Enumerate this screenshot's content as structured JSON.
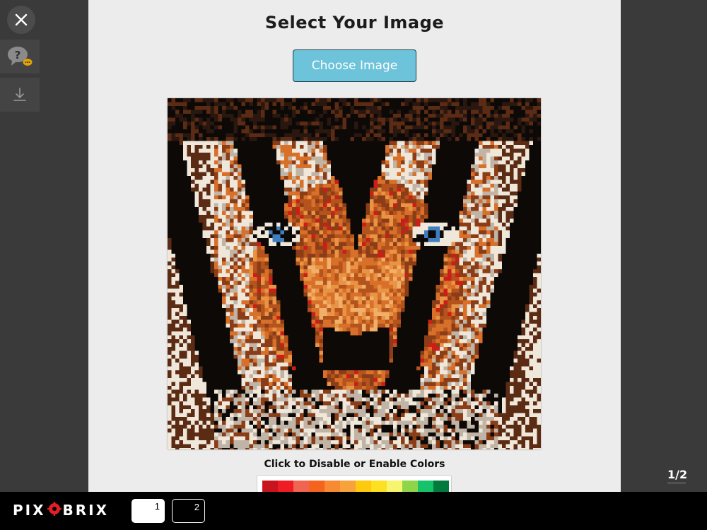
{
  "header": {
    "title": "Select Your Image",
    "choose_button_label": "Choose Image"
  },
  "sidebar": {
    "close_icon": "close-icon",
    "help_icon": "help-chat-icon",
    "download_icon": "download-icon"
  },
  "artwork": {
    "subject": "pixelated tiger face mosaic",
    "colors": [
      "#0c0907",
      "#2a170f",
      "#5c2b14",
      "#8b3d17",
      "#b4531c",
      "#d8702a",
      "#e89444",
      "#f0b06a",
      "#efe7d9",
      "#bfb4a6",
      "#cc1e17",
      "#3f7fbf"
    ]
  },
  "palette": {
    "label": "Click to Disable or Enable Colors",
    "swatches": [
      "#c8141c",
      "#ee1c25",
      "#f06452",
      "#f4641e",
      "#f78a32",
      "#f8a23c",
      "#ffc90e",
      "#fde021",
      "#f7f46e",
      "#8fd54a",
      "#17c36a",
      "#007a3d"
    ]
  },
  "pager": {
    "indicator": "1/2",
    "pages": [
      "1",
      "2"
    ]
  },
  "brand": {
    "left": "PIX",
    "right": "BRIX",
    "mark_color": "#e21f26"
  }
}
